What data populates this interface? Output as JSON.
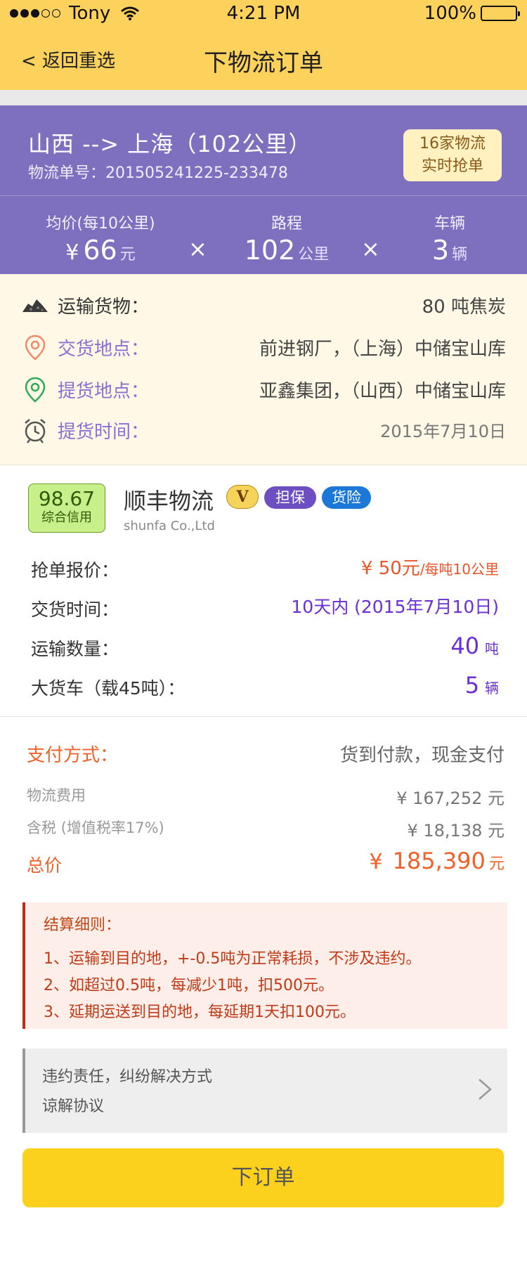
{
  "status_bar": {
    "carrier": "Tony",
    "time": "4:21 PM",
    "battery": "100%"
  },
  "nav": {
    "back_label": "< 返回重选",
    "title": "下物流订单"
  },
  "route": {
    "title": "山西 --> 上海（102公里）",
    "order_no": "物流单号：201505241225-233478",
    "badge_line1": "16家物流",
    "badge_line2": "实时抢单",
    "metrics": {
      "avg_label": "均价(每10公里)",
      "avg_currency": "¥",
      "avg_value": "66",
      "avg_unit": "元",
      "distance_label": "路程",
      "distance_value": "102",
      "distance_unit": "公里",
      "vehicles_label": "车辆",
      "vehicles_value": "3",
      "vehicles_unit": "辆",
      "operator": "×"
    }
  },
  "cargo": {
    "goods_label": "运输货物：",
    "goods_value": "80 吨焦炭",
    "delivery_label": "交货地点：",
    "delivery_value": "前进钢厂，（上海）中储宝山库",
    "pickup_label": "提货地点：",
    "pickup_value": "亚鑫集团，（山西）中储宝山库",
    "pickup_time_label": "提货时间：",
    "pickup_time_value": "2015年7月10日"
  },
  "company": {
    "credit_score": "98.67",
    "credit_label": "综合信用",
    "name": "顺丰物流",
    "name_en": "shunfa Co.,Ltd",
    "v_badge": "V",
    "tag_guarantee": "担保",
    "tag_insurance": "货险",
    "quote_label": "抢单报价：",
    "quote_value": "¥ 50元",
    "quote_unit": "/每吨10公里",
    "delivery_time_label": "交货时间：",
    "delivery_time_value": "10天内 (2015年7月10日)",
    "quantity_label": "运输数量：",
    "quantity_value": "40",
    "quantity_unit": "吨",
    "truck_label": "大货车（载45吨）：",
    "truck_value": "5",
    "truck_unit": "辆"
  },
  "payment": {
    "method_label": "支付方式：",
    "method_value": "货到付款，现金支付",
    "fee_label": "物流费用",
    "fee_value": "¥ 167,252 元",
    "tax_label": "含税 (增值税率17%)",
    "tax_value": "¥ 18,138 元",
    "total_label": "总价",
    "total_currency": "¥",
    "total_value": "185,390",
    "total_unit": "元"
  },
  "rules": {
    "title": "结算细则：",
    "lines": [
      "1、运输到目的地，+-0.5吨为正常耗损，不涉及违约。",
      "2、如超过0.5吨，每减少1吨，扣500元。",
      "3、延期运送到目的地，每延期1天扣100元。"
    ]
  },
  "agreement": {
    "line1": "违约责任，纠纷解决方式",
    "line2": "谅解协议"
  },
  "submit_label": "下订单",
  "colors": {
    "brand_yellow": "#fdd25c",
    "route_purple": "#7e6fbf",
    "accent_red": "#e8552a",
    "accent_violet": "#6b2fd6",
    "button_yellow": "#fcd11d"
  }
}
